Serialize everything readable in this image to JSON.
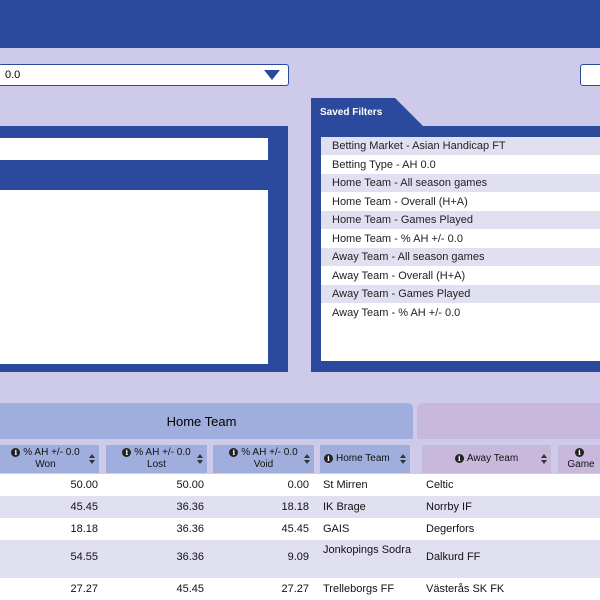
{
  "select": {
    "value": "0.0"
  },
  "saved_filters": {
    "title": "Saved Filters",
    "items": [
      "Betting Market - Asian Handicap FT",
      "Betting Type - AH 0.0",
      "Home Team - All season games",
      "Home Team - Overall (H+A)",
      "Home Team - Games Played",
      "Home Team - % AH +/- 0.0",
      "Away Team - All season games",
      "Away Team - Overall (H+A)",
      "Away Team - Games Played",
      "Away Team - % AH +/- 0.0"
    ]
  },
  "table": {
    "home_group": "Home Team",
    "columns": {
      "won": [
        "% AH +/- 0.0",
        "Won"
      ],
      "lost": [
        "% AH +/- 0.0",
        "Lost"
      ],
      "void": [
        "% AH +/- 0.0",
        "Void"
      ],
      "home_team": "Home Team",
      "away_team": "Away Team",
      "games": "Game"
    },
    "rows": [
      {
        "won": "50.00",
        "lost": "50.00",
        "void": "0.00",
        "home": "St Mirren",
        "away": "Celtic"
      },
      {
        "won": "45.45",
        "lost": "36.36",
        "void": "18.18",
        "home": "IK Brage",
        "away": "Norrby IF"
      },
      {
        "won": "18.18",
        "lost": "36.36",
        "void": "45.45",
        "home": "GAIS",
        "away": "Degerfors"
      },
      {
        "won": "54.55",
        "lost": "36.36",
        "void": "9.09",
        "home": "Jonkopings Sodra",
        "away": "Dalkurd FF"
      },
      {
        "won": "27.27",
        "lost": "45.45",
        "void": "27.27",
        "home": "Trelleborgs FF",
        "away": "Västerås SK FK"
      }
    ]
  },
  "colors": {
    "primary": "#2b4a9e",
    "background": "#cdcbe9",
    "home_header": "#a0aedd",
    "away_header": "#c8b9dc",
    "row_alt": "#e1e0f1"
  },
  "icons": {
    "info": "info-circle-icon",
    "sort": "sort-arrows-icon",
    "dropdown": "caret-down-icon"
  }
}
